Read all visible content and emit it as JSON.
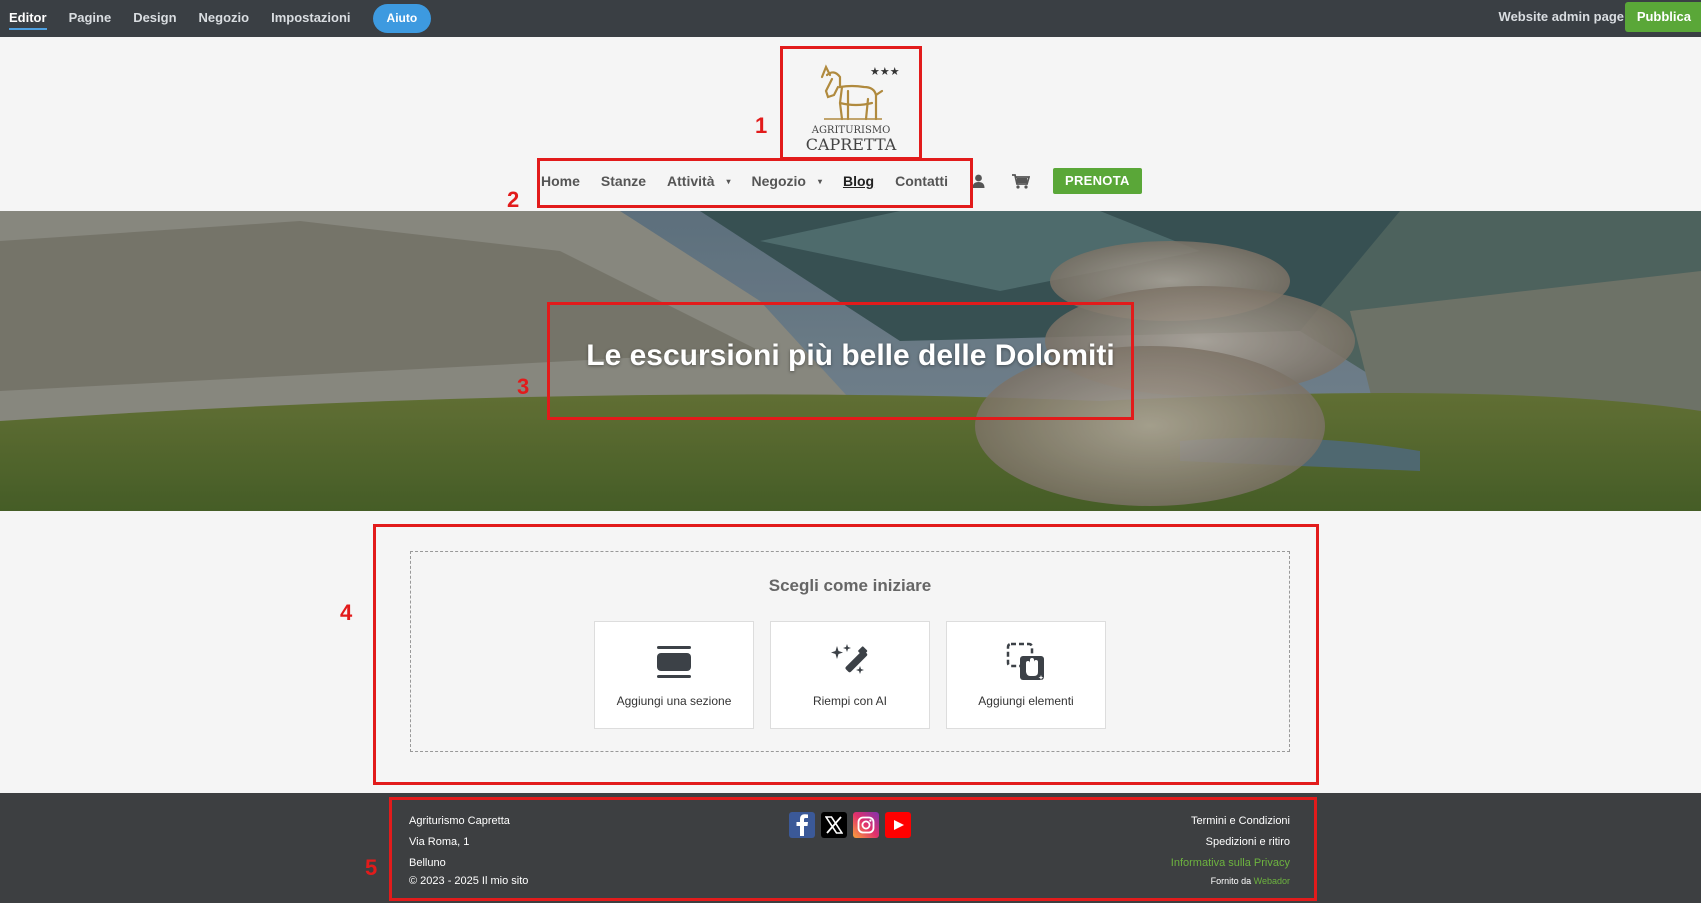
{
  "editor_bar": {
    "tabs": [
      "Editor",
      "Pagine",
      "Design",
      "Negozio",
      "Impostazioni"
    ],
    "help_label": "Aiuto",
    "admin_label": "Website admin page",
    "publish_label": "Pubblica"
  },
  "header": {
    "logo": {
      "line1": "AGRITURISMO",
      "line2": "CAPRETTA",
      "stars": "★★★"
    },
    "nav": {
      "items": [
        "Home",
        "Stanze",
        "Attività",
        "Negozio",
        "Blog",
        "Contatti"
      ],
      "caret": "▾",
      "cta_label": "PRENOTA"
    }
  },
  "hero": {
    "title": "Le escursioni più belle delle Dolomiti"
  },
  "start_section": {
    "heading": "Scegli come iniziare",
    "cards": [
      "Aggiungi una sezione",
      "Riempi con AI",
      "Aggiungi elementi"
    ]
  },
  "footer": {
    "name": "Agriturismo Capretta",
    "address": "Via Roma, 1",
    "city": "Belluno",
    "copyright": "© 2023 - 2025 Il mio sito",
    "links": [
      "Termini e Condizioni",
      "Spedizioni e ritiro",
      "Informativa sulla Privacy"
    ],
    "powered_prefix": "Fornito da",
    "powered_brand": "Webador"
  },
  "annotations": [
    "1",
    "2",
    "3",
    "4",
    "5"
  ],
  "colors": {
    "topbar": "#3a3f44",
    "accent_blue": "#3d9ae0",
    "green": "#5aa738",
    "annotation_red": "#e21b1b",
    "footer": "#3d3f41",
    "logo_gold": "#b08a3e"
  }
}
